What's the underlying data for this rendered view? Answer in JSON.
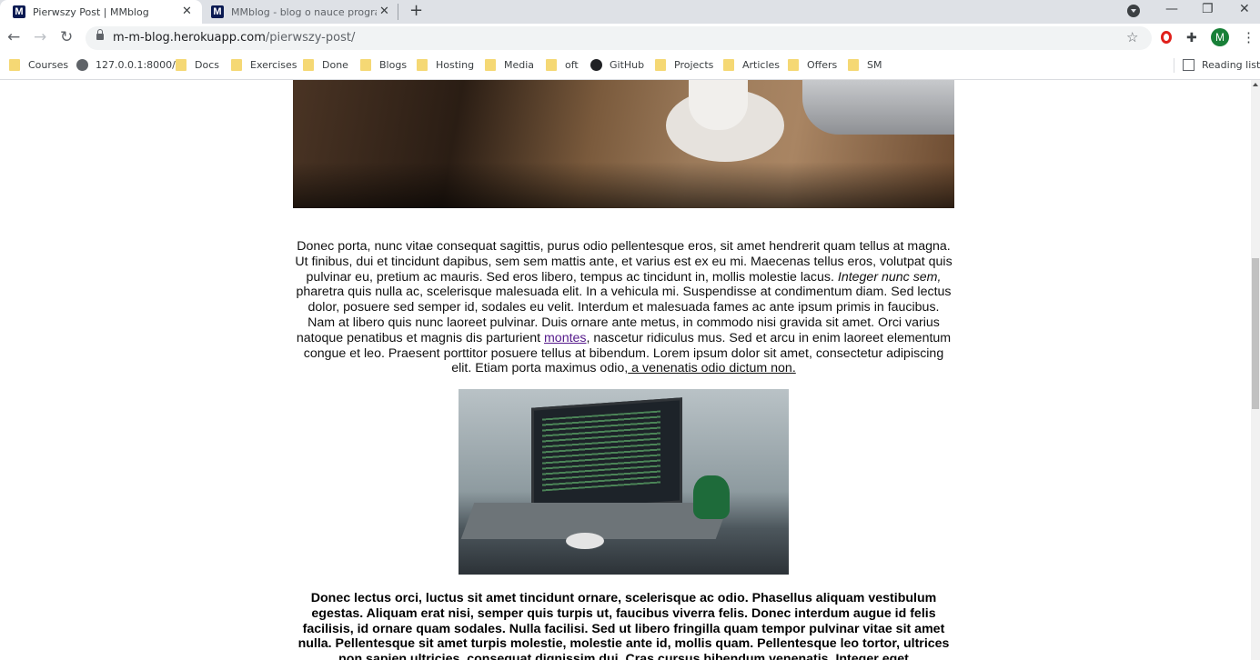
{
  "browser": {
    "tabs": [
      {
        "favicon": "M",
        "title": "Pierwszy Post | MMblog",
        "active": true
      },
      {
        "favicon": "M",
        "title": "MMblog - blog o nauce program",
        "active": false
      }
    ],
    "url_host": "m-m-blog.herokuapp.com",
    "url_path": "/pierwszy-post/",
    "avatar_initial": "M",
    "bookmarks": [
      {
        "label": "Courses",
        "icon": "folder-icon"
      },
      {
        "label": "127.0.0.1:8000/",
        "icon": "globe-icon"
      },
      {
        "label": "Docs",
        "icon": "folder-icon"
      },
      {
        "label": "Exercises",
        "icon": "folder-icon"
      },
      {
        "label": "Done",
        "icon": "folder-icon"
      },
      {
        "label": "Blogs",
        "icon": "folder-icon"
      },
      {
        "label": "Hosting",
        "icon": "folder-icon"
      },
      {
        "label": "Media",
        "icon": "folder-icon"
      },
      {
        "label": "oft",
        "icon": "folder-icon"
      },
      {
        "label": "GitHub",
        "icon": "github-icon"
      },
      {
        "label": "Projects",
        "icon": "folder-icon"
      },
      {
        "label": "Articles",
        "icon": "folder-icon"
      },
      {
        "label": "Offers",
        "icon": "folder-icon"
      },
      {
        "label": "SM",
        "icon": "folder-icon"
      }
    ],
    "reading_list": "Reading list"
  },
  "post": {
    "p1_a": "Donec porta, nunc vitae consequat sagittis, purus odio pellentesque eros, sit amet hendrerit quam tellus at magna. Ut finibus, dui et tincidunt dapibus, sem sem mattis ante, et varius est ex eu mi. Maecenas tellus eros, volutpat quis pulvinar eu, pretium ac mauris. Sed eros libero, tempus ac tincidunt in, mollis molestie lacus.",
    "p1_italic": "Integer nunc sem,",
    "p1_b": " pharetra quis nulla ac, scelerisque malesuada elit. In a vehicula mi. Suspendisse at condimentum diam. Sed lectus dolor, posuere sed semper id, sodales eu velit. Interdum et malesuada fames ac ante ipsum primis in faucibus. Nam at libero quis nunc laoreet pulvinar. Duis ornare ante metus, in commodo nisi gravida sit amet. Orci varius natoque penatibus et magnis dis parturient ",
    "p1_link": "montes",
    "p1_c": ", nascetur ridiculus mus. Sed et arcu in enim laoreet elementum congue et leo. Praesent porttitor posuere tellus at bibendum. Lorem ipsum dolor sit amet, consectetur adipiscing elit. Etiam porta maximus odio,",
    "p1_underlined": " a venenatis odio dictum non.",
    "p2": "Donec lectus orci, luctus sit amet tincidunt ornare, scelerisque ac odio. Phasellus aliquam vestibulum egestas. Aliquam erat nisi, semper quis turpis ut, faucibus viverra felis. Donec interdum augue id felis facilisis, id ornare quam sodales. Nulla facilisi. Sed ut libero fringilla quam tempor pulvinar vitae sit amet nulla. Pellentesque sit amet turpis molestie, molestie ante id, mollis quam. Pellentesque leo tortor, ultrices non sapien ultricies, consequat dignissim dui. Cras cursus bibendum venenatis. Integer eget"
  }
}
